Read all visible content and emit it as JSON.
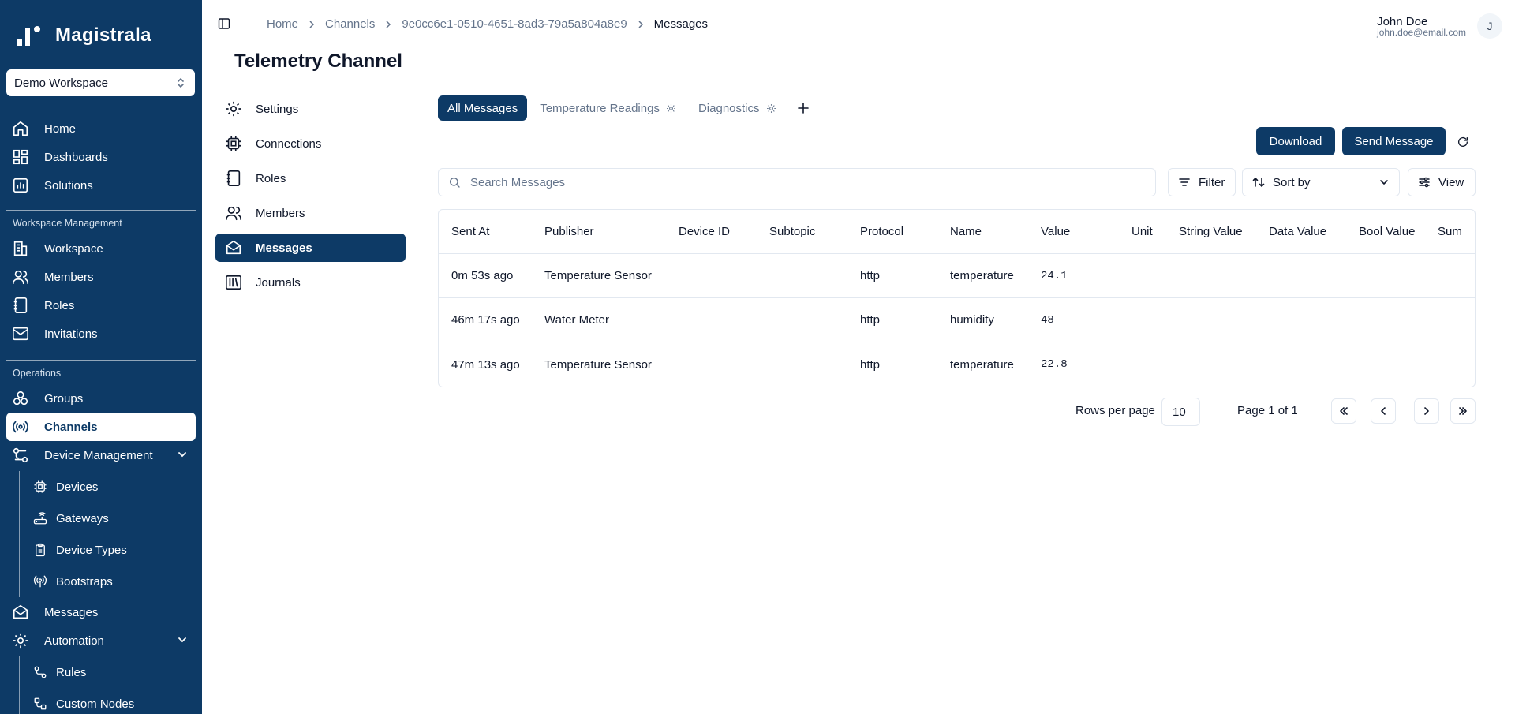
{
  "brand": {
    "name": "Magistrala"
  },
  "workspace_select": {
    "value": "Demo Workspace"
  },
  "sidebar": {
    "main_items": [
      {
        "label": "Home",
        "icon": "home-icon"
      },
      {
        "label": "Dashboards",
        "icon": "dashboard-icon"
      },
      {
        "label": "Solutions",
        "icon": "solutions-icon"
      }
    ],
    "workspace_section": {
      "label": "Workspace Management",
      "items": [
        {
          "label": "Workspace",
          "icon": "building-icon"
        },
        {
          "label": "Members",
          "icon": "users-icon"
        },
        {
          "label": "Roles",
          "icon": "notebook-icon"
        },
        {
          "label": "Invitations",
          "icon": "mail-icon"
        }
      ]
    },
    "operations_section": {
      "label": "Operations",
      "groups": "Groups",
      "channels": "Channels",
      "device_management": {
        "label": "Device Management",
        "items": [
          "Devices",
          "Gateways",
          "Device Types",
          "Bootstraps"
        ]
      },
      "messages": "Messages",
      "automation": {
        "label": "Automation",
        "items": [
          "Rules",
          "Custom Nodes"
        ]
      }
    }
  },
  "breadcrumb": [
    "Home",
    "Channels",
    "9e0cc6e1-0510-4651-8ad3-79a5a804a8e9",
    "Messages"
  ],
  "user": {
    "name": "John Doe",
    "email": "john.doe@email.com",
    "initial": "J"
  },
  "page_title": "Telemetry Channel",
  "channel_nav": [
    {
      "label": "Settings",
      "icon": "gear-icon"
    },
    {
      "label": "Connections",
      "icon": "chip-icon"
    },
    {
      "label": "Roles",
      "icon": "notebook-icon"
    },
    {
      "label": "Members",
      "icon": "users-icon"
    },
    {
      "label": "Messages",
      "icon": "mail-open-icon",
      "active": true
    },
    {
      "label": "Journals",
      "icon": "library-icon"
    }
  ],
  "tabs": [
    "All Messages",
    "Temperature Readings",
    "Diagnostics"
  ],
  "actions": {
    "download": "Download",
    "send_message": "Send Message"
  },
  "search": {
    "placeholder": "Search Messages",
    "value": ""
  },
  "controls": {
    "filter": "Filter",
    "sort": "Sort by",
    "view": "View"
  },
  "table": {
    "columns": [
      "Sent At",
      "Publisher",
      "Device ID",
      "Subtopic",
      "Protocol",
      "Name",
      "Value",
      "Unit",
      "String Value",
      "Data Value",
      "Bool Value",
      "Sum"
    ],
    "rows": [
      {
        "sent_at": "0m 53s ago",
        "publisher": "Temperature Sensor",
        "device_id": "",
        "subtopic": "",
        "protocol": "http",
        "name": "temperature",
        "value": "24.1",
        "unit": "",
        "string_value": "",
        "data_value": "",
        "bool_value": "",
        "sum": ""
      },
      {
        "sent_at": "46m 17s ago",
        "publisher": "Water Meter",
        "device_id": "",
        "subtopic": "",
        "protocol": "http",
        "name": "humidity",
        "value": "48",
        "unit": "",
        "string_value": "",
        "data_value": "",
        "bool_value": "",
        "sum": ""
      },
      {
        "sent_at": "47m 13s ago",
        "publisher": "Temperature Sensor",
        "device_id": "",
        "subtopic": "",
        "protocol": "http",
        "name": "temperature",
        "value": "22.8",
        "unit": "",
        "string_value": "",
        "data_value": "",
        "bool_value": "",
        "sum": ""
      }
    ]
  },
  "pagination": {
    "rows_per_page_label": "Rows per page",
    "rows_per_page": "10",
    "page_info": "Page 1 of 1"
  }
}
